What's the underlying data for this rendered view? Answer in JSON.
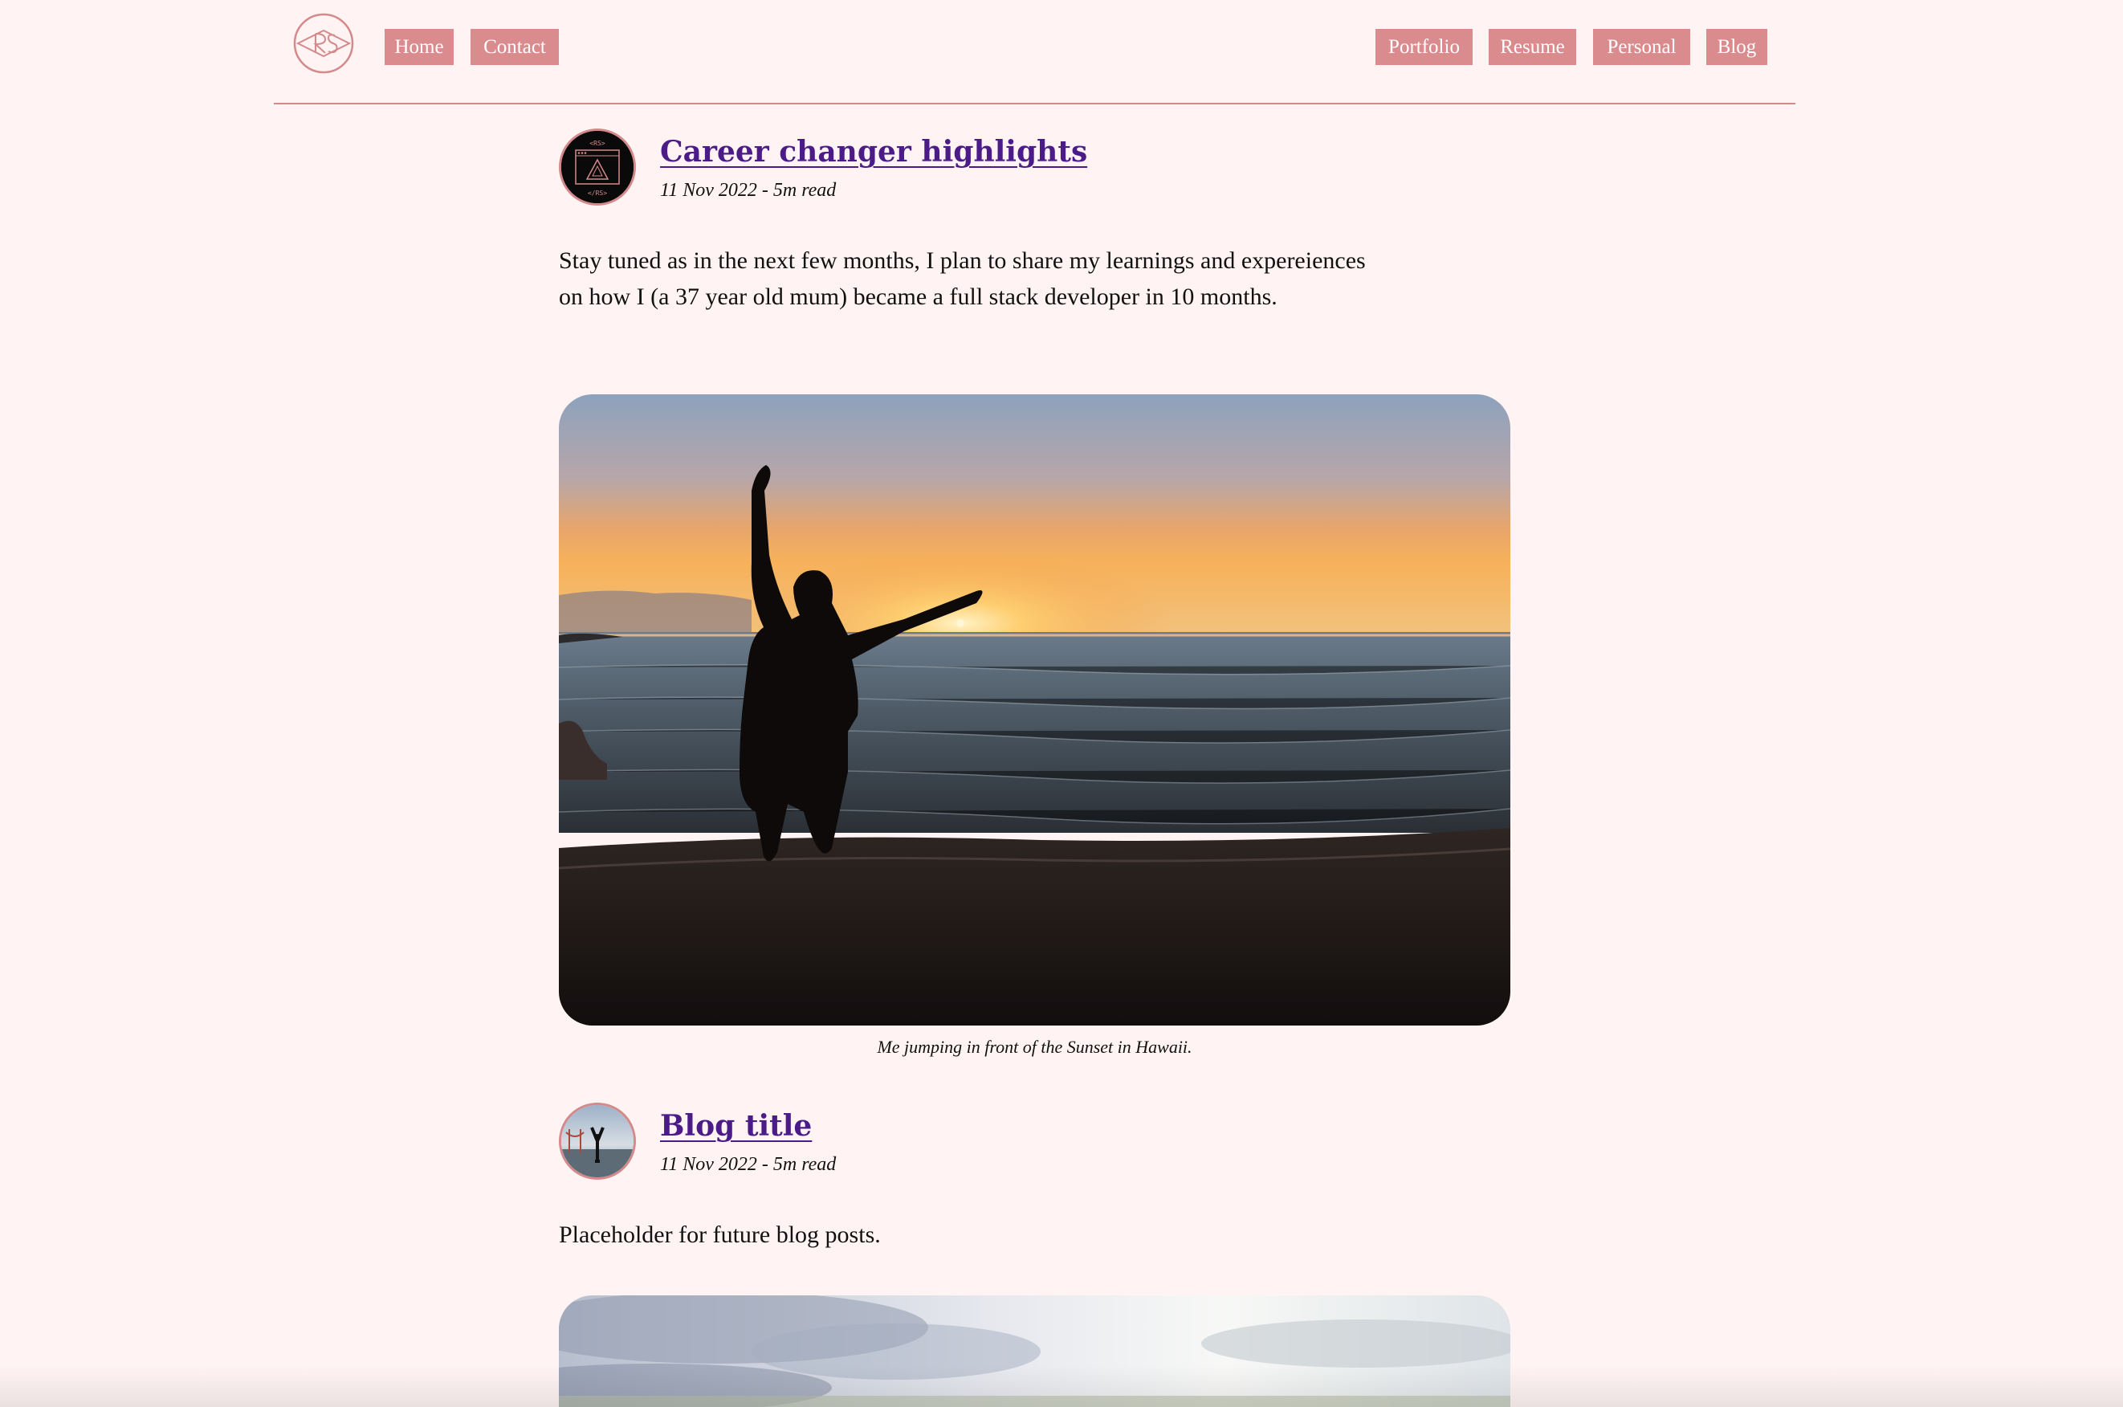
{
  "nav": {
    "left_items": [
      {
        "label": "Home"
      },
      {
        "label": "Contact"
      }
    ],
    "right_items": [
      {
        "label": "Portfolio"
      },
      {
        "label": "Resume"
      },
      {
        "label": "Personal"
      },
      {
        "label": "Blog"
      }
    ],
    "logo_icon": "rs-monogram-logo"
  },
  "posts": [
    {
      "title": "Career changer highlights",
      "meta": "11 Nov 2022 - 5m read",
      "body": "Stay tuned as in the next few months, I plan to share my learnings and expereiences on how I (a 37 year old mum) became a full stack developer in 10 months.",
      "image_caption": "Me jumping in front of the Sunset in Hawaii.",
      "avatar_icon": "code-window-icon"
    },
    {
      "title": "Blog title",
      "meta": "11 Nov 2022 - 5m read",
      "body": "Placeholder for future blog posts.",
      "avatar_icon": "beach-photo-avatar"
    }
  ],
  "colors": {
    "background": "#fff3f3",
    "accent": "#d98b8e",
    "link": "#4b1c88"
  }
}
